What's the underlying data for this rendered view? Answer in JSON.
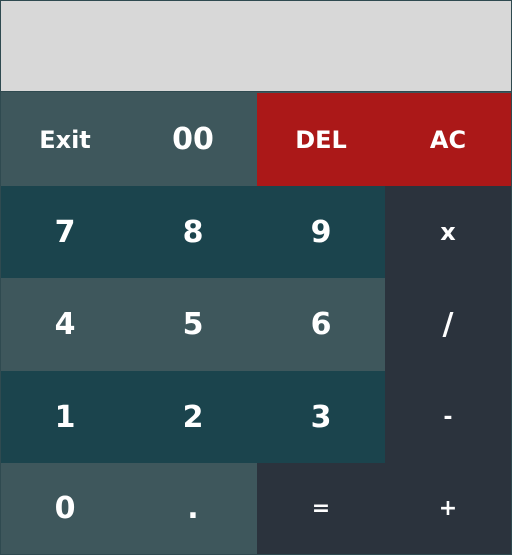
{
  "display": {
    "value": ""
  },
  "keys": {
    "exit": "Exit",
    "double_zero": "00",
    "del": "DEL",
    "ac": "AC",
    "seven": "7",
    "eight": "8",
    "nine": "9",
    "multiply": "x",
    "four": "4",
    "five": "5",
    "six": "6",
    "divide": "/",
    "one": "1",
    "two": "2",
    "three": "3",
    "minus": "-",
    "zero": "0",
    "dot": ".",
    "equals": "=",
    "plus": "+"
  },
  "colors": {
    "light_key": "#3e575c",
    "dark_key": "#1b444d",
    "danger_key": "#ab1818",
    "operator_key": "#2b333d",
    "display_bg": "#d8d8d8"
  }
}
